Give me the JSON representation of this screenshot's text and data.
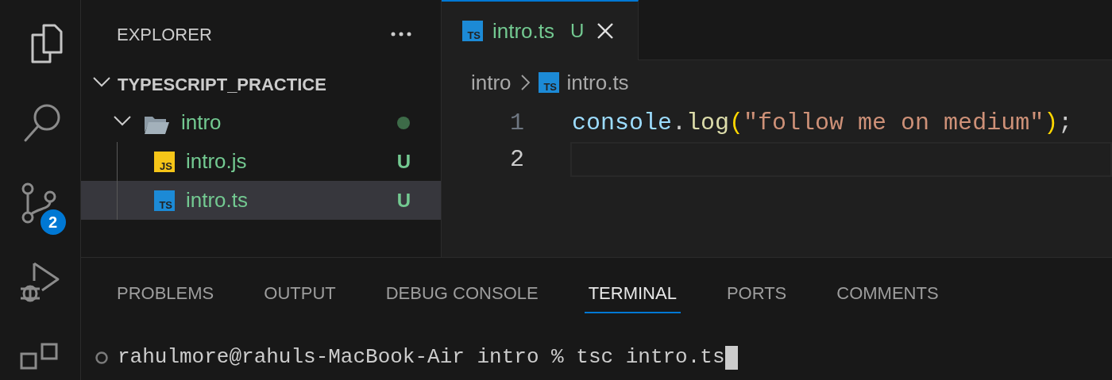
{
  "activity_bar": {
    "items": [
      {
        "kind": "files"
      },
      {
        "kind": "search"
      },
      {
        "kind": "source-control",
        "badge": "2"
      },
      {
        "kind": "run-debug"
      },
      {
        "kind": "extensions"
      }
    ]
  },
  "sidebar": {
    "title": "EXPLORER",
    "tree": {
      "label": "TYPESCRIPT_PRACTICE",
      "expanded": true,
      "children": [
        {
          "label": "intro",
          "kind": "folder",
          "expanded": true,
          "has_changes": true,
          "children": [
            {
              "label": "intro.js",
              "kind": "js",
              "icon_text": "JS",
              "status": "U",
              "selected": false
            },
            {
              "label": "intro.ts",
              "kind": "ts",
              "icon_text": "TS",
              "status": "U",
              "selected": true
            }
          ]
        }
      ]
    }
  },
  "editor": {
    "tabs": [
      {
        "label": "intro.ts",
        "kind": "ts",
        "icon_text": "TS",
        "status": "U",
        "selected": true
      }
    ],
    "breadcrumbs": [
      {
        "label": "intro",
        "kind": "folder"
      },
      {
        "label": "intro.ts",
        "kind": "ts",
        "icon_text": "TS"
      }
    ],
    "lines": [
      {
        "number": "1",
        "current": false,
        "tokens": [
          {
            "text": "console",
            "kind": "variable"
          },
          {
            "text": ".",
            "kind": "punct"
          },
          {
            "text": "log",
            "kind": "function"
          },
          {
            "text": "(",
            "kind": "bracket"
          },
          {
            "text": "\"follow me on medium\"",
            "kind": "string"
          },
          {
            "text": ")",
            "kind": "bracket"
          },
          {
            "text": ";",
            "kind": "punct"
          }
        ]
      },
      {
        "number": "2",
        "current": true
      }
    ]
  },
  "panel": {
    "tabs": [
      {
        "label": "PROBLEMS",
        "selected": false
      },
      {
        "label": "OUTPUT",
        "selected": false
      },
      {
        "label": "DEBUG CONSOLE",
        "selected": false
      },
      {
        "label": "TERMINAL",
        "selected": true
      },
      {
        "label": "PORTS",
        "selected": false
      },
      {
        "label": "COMMENTS",
        "selected": false
      }
    ],
    "terminal": {
      "lines": [
        {
          "text": "rahulmore@rahuls-MacBook-Air intro % tsc intro.ts",
          "cursor": true
        }
      ]
    }
  }
}
